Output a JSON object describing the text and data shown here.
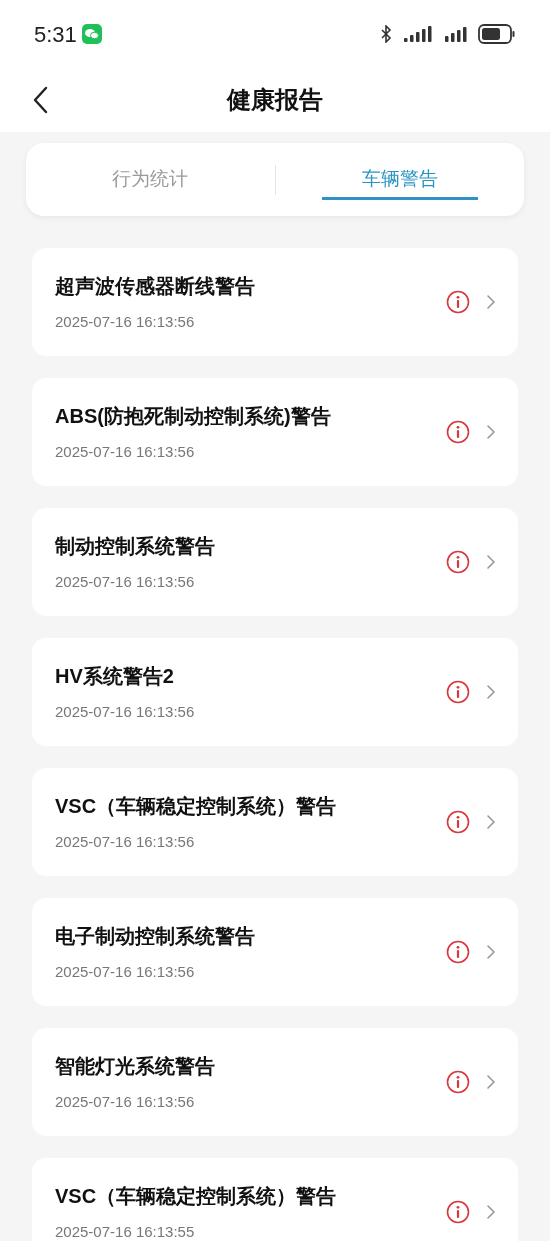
{
  "status_bar": {
    "time": "5:31"
  },
  "header": {
    "title": "健康报告"
  },
  "tabs": [
    {
      "label": "行为统计",
      "selected": false
    },
    {
      "label": "车辆警告",
      "selected": true
    }
  ],
  "warnings": [
    {
      "title": "超声波传感器断线警告",
      "time": "2025-07-16 16:13:56"
    },
    {
      "title": "ABS(防抱死制动控制系统)警告",
      "time": "2025-07-16 16:13:56"
    },
    {
      "title": "制动控制系统警告",
      "time": "2025-07-16 16:13:56"
    },
    {
      "title": "HV系统警告2",
      "time": "2025-07-16 16:13:56"
    },
    {
      "title": "VSC（车辆稳定控制系统）警告",
      "time": "2025-07-16 16:13:56"
    },
    {
      "title": "电子制动控制系统警告",
      "time": "2025-07-16 16:13:56"
    },
    {
      "title": "智能灯光系统警告",
      "time": "2025-07-16 16:13:56"
    },
    {
      "title": "VSC（车辆稳定控制系统）警告",
      "time": "2025-07-16 16:13:55"
    }
  ]
}
